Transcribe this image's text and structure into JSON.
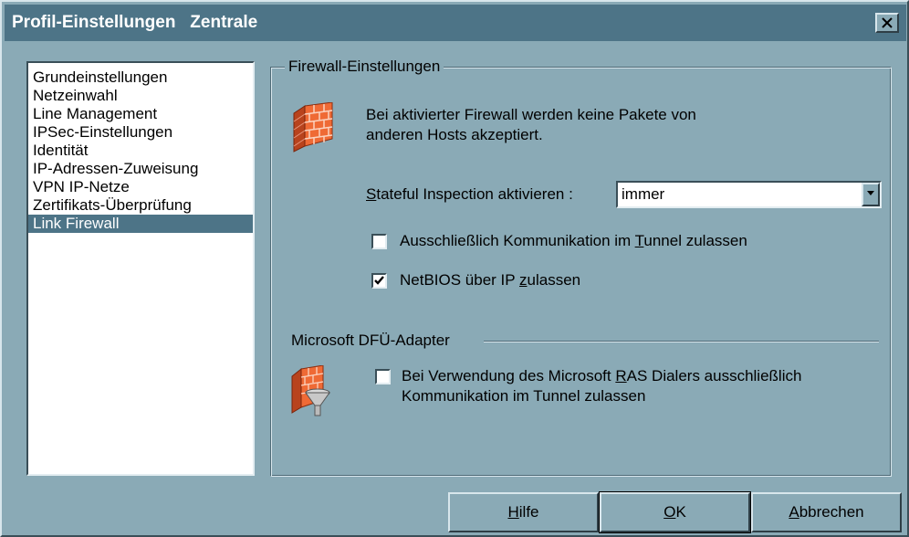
{
  "window": {
    "title": "Profil-Einstellungen   Zentrale",
    "close_icon": "close-icon"
  },
  "sidebar": {
    "items": [
      {
        "label": "Grundeinstellungen"
      },
      {
        "label": "Netzeinwahl"
      },
      {
        "label": "Line Management"
      },
      {
        "label": "IPSec-Einstellungen"
      },
      {
        "label": "Identität"
      },
      {
        "label": "IP-Adressen-Zuweisung"
      },
      {
        "label": "VPN IP-Netze"
      },
      {
        "label": "Zertifikats-Überprüfung"
      },
      {
        "label": "Link Firewall"
      }
    ],
    "selected_index": 8
  },
  "firewall": {
    "group_title": "Firewall-Einstellungen",
    "description_line1": "Bei aktivierter Firewall werden keine Pakete von",
    "description_line2": "anderen Hosts akzeptiert.",
    "stateful": {
      "label_prefix": "",
      "label_accel": "S",
      "label_rest": "tateful Inspection aktivieren :",
      "value": "immer"
    },
    "tunnel_only": {
      "checked": false,
      "label_pre": "Ausschließlich Kommunikation im ",
      "label_accel": "T",
      "label_post": "unnel zulassen"
    },
    "netbios": {
      "checked": true,
      "label_pre": "NetBIOS über IP ",
      "label_accel": "z",
      "label_post": "ulassen"
    }
  },
  "dfu": {
    "section_title": "Microsoft DFÜ-Adapter",
    "ras": {
      "checked": false,
      "label_pre": "Bei Verwendung des Microsoft ",
      "label_accel": "R",
      "label_post": "AS Dialers ausschließlich",
      "label_line2": "Kommunikation im Tunnel zulassen"
    }
  },
  "buttons": {
    "help_accel": "H",
    "help_rest": "ilfe",
    "ok_accel": "O",
    "ok_rest": "K",
    "cancel_accel": "A",
    "cancel_rest": "bbrechen"
  },
  "colors": {
    "dialog_bg": "#8aaab6",
    "titlebar_bg": "#4d7487",
    "selection_bg": "#4d7487",
    "wall_brick": "#e05a2a"
  }
}
